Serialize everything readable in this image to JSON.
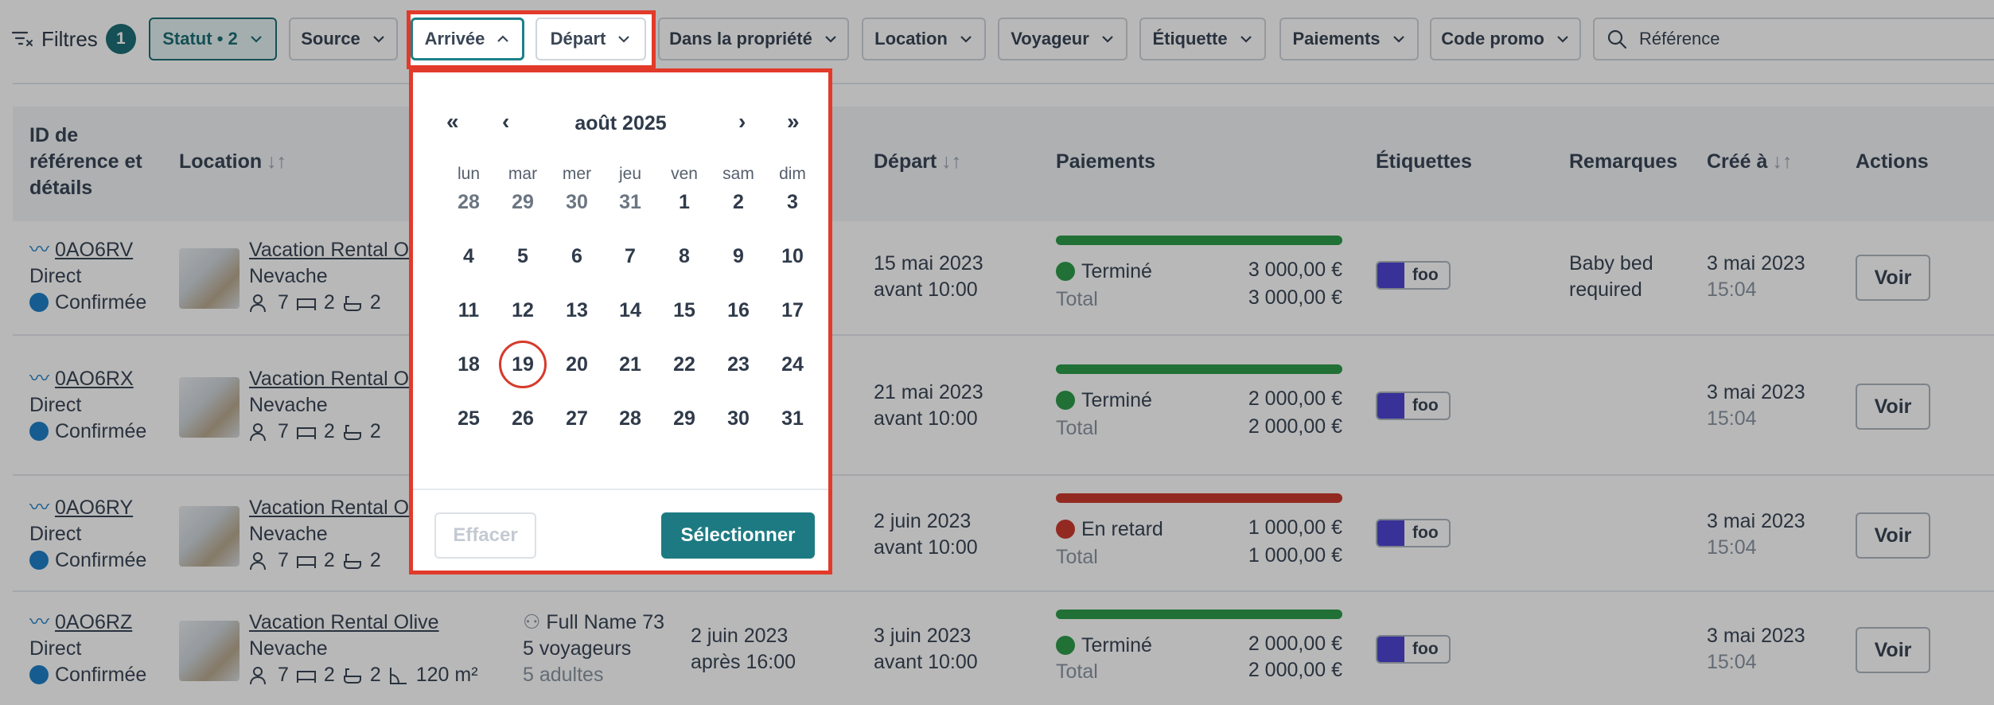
{
  "filters": {
    "label": "Filtres",
    "count": "1",
    "buttons": {
      "statut": "Statut • 2",
      "source": "Source",
      "arrivee": "Arrivée",
      "depart": "Départ",
      "propriete": "Dans la propriété",
      "location": "Location",
      "voyageur": "Voyageur",
      "etiquette": "Étiquette",
      "paiements": "Paiements",
      "code_promo": "Code promo"
    },
    "search_placeholder": "Référence"
  },
  "table": {
    "headers": {
      "ref_line1": "ID de",
      "ref_line2": "référence et",
      "ref_line3": "détails",
      "location": "Location",
      "depart": "Départ",
      "paiements": "Paiements",
      "etiquettes": "Étiquettes",
      "remarques": "Remarques",
      "cree": "Créé à",
      "actions": "Actions"
    },
    "rows": [
      {
        "ref": "0AO6RV",
        "source": "Direct",
        "status": "Confirmée",
        "name": "Vacation Rental Ol",
        "place": "Nevache",
        "guests": "7",
        "bedrooms": "2",
        "baths": "2",
        "depart_date": "15 mai 2023",
        "depart_time": "avant 10:00",
        "pay_status": "Terminé",
        "pay_amount": "3 000,00 €",
        "total_label": "Total",
        "total": "3 000,00 €",
        "tag": "foo",
        "remark1": "Baby bed",
        "remark2": "required",
        "created_date": "3 mai 2023",
        "created_time": "15:04",
        "action": "Voir"
      },
      {
        "ref": "0AO6RX",
        "source": "Direct",
        "status": "Confirmée",
        "name": "Vacation Rental Ol",
        "place": "Nevache",
        "guests": "7",
        "bedrooms": "2",
        "baths": "2",
        "depart_date": "21 mai 2023",
        "depart_time": "avant 10:00",
        "pay_status": "Terminé",
        "pay_amount": "2 000,00 €",
        "total_label": "Total",
        "total": "2 000,00 €",
        "tag": "foo",
        "created_date": "3 mai 2023",
        "created_time": "15:04",
        "action": "Voir"
      },
      {
        "ref": "0AO6RY",
        "source": "Direct",
        "status": "Confirmée",
        "name": "Vacation Rental Ol",
        "place": "Nevache",
        "guests": "7",
        "bedrooms": "2",
        "baths": "2",
        "depart_date": "2 juin 2023",
        "depart_time": "avant 10:00",
        "pay_status": "En retard",
        "pay_amount": "1 000,00 €",
        "total_label": "Total",
        "total": "1 000,00 €",
        "tag": "foo",
        "created_date": "3 mai 2023",
        "created_time": "15:04",
        "action": "Voir"
      },
      {
        "ref": "0AO6RZ",
        "source": "Direct",
        "status": "Confirmée",
        "name": "Vacation Rental Olive",
        "place": "Nevache",
        "guests": "7",
        "bedrooms": "2",
        "baths": "2",
        "area": "120 m²",
        "guest_name": "Full Name 73",
        "guest_count": "5 voyageurs",
        "guest_adults": "5 adultes",
        "arrival_date": "2 juin 2023",
        "arrival_time": "après 16:00",
        "depart_date": "3 juin 2023",
        "depart_time": "avant 10:00",
        "pay_status": "Terminé",
        "pay_amount": "2 000,00 €",
        "total_label": "Total",
        "total": "2 000,00 €",
        "tag": "foo",
        "created_date": "3 mai 2023",
        "created_time": "15:04",
        "action": "Voir"
      }
    ]
  },
  "calendar": {
    "title": "août 2025",
    "nav": {
      "prev_year": "«",
      "prev_month": "‹",
      "next_month": "›",
      "next_year": "»"
    },
    "weekdays": [
      "lun",
      "mar",
      "mer",
      "jeu",
      "ven",
      "sam",
      "dim"
    ],
    "weeks": [
      [
        "28",
        "29",
        "30",
        "31",
        "1",
        "2",
        "3"
      ],
      [
        "4",
        "5",
        "6",
        "7",
        "8",
        "9",
        "10"
      ],
      [
        "11",
        "12",
        "13",
        "14",
        "15",
        "16",
        "17"
      ],
      [
        "18",
        "19",
        "20",
        "21",
        "22",
        "23",
        "24"
      ],
      [
        "25",
        "26",
        "27",
        "28",
        "29",
        "30",
        "31"
      ]
    ],
    "clear_label": "Effacer",
    "select_label": "Sélectionner"
  },
  "colors": {
    "accent": "#1d7a82",
    "highlight": "#e23a2a",
    "pay_ok": "#2f9c4b",
    "pay_late": "#cc3b2f",
    "tag": "#4d45d3"
  }
}
